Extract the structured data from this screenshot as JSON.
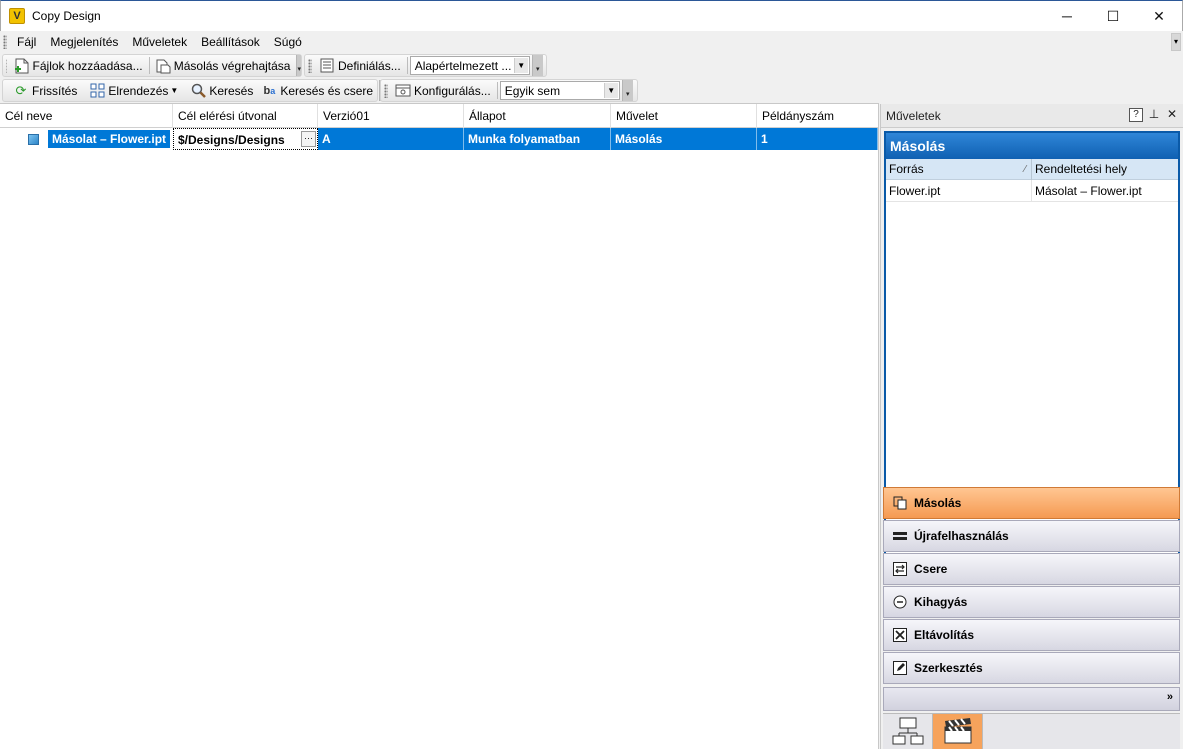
{
  "window": {
    "title": "Copy Design",
    "app_icon_letter": "V",
    "controls": {
      "minimize": "─",
      "maximize": "☐",
      "close": "✕"
    }
  },
  "menu": [
    "Fájl",
    "Megjelenítés",
    "Műveletek",
    "Beállítások",
    "Súgó"
  ],
  "toolbar1": {
    "add_files": "Fájlok hozzáadása...",
    "execute_copy": "Másolás végrehajtása",
    "define": "Definiálás...",
    "preset_value": "Alapértelmezett ..."
  },
  "toolbar2": {
    "refresh": "Frissítés",
    "arrange": "Elrendezés",
    "search": "Keresés",
    "search_replace": "Keresés és csere",
    "configure": "Konfigurálás...",
    "filter_value": "Egyik sem"
  },
  "grid": {
    "columns": [
      "Cél neve",
      "Cél elérési útvonal",
      "Verzió01",
      "Állapot",
      "Művelet",
      "Példányszám"
    ],
    "rows": [
      {
        "name": "Másolat – Flower.ipt",
        "path": "$/Designs/Designs",
        "version": "A",
        "status": "Munka folyamatban",
        "action": "Másolás",
        "count": "1"
      }
    ]
  },
  "panel": {
    "title": "Műveletek",
    "header": "Másolás",
    "columns": [
      "Forrás",
      "Rendeltetési hely"
    ],
    "rows": [
      {
        "source": "Flower.ipt",
        "dest": "Másolat – Flower.ipt"
      }
    ],
    "actions": [
      {
        "label": "Másolás",
        "icon": "copy-icon"
      },
      {
        "label": "Újrafelhasználás",
        "icon": "reuse-icon"
      },
      {
        "label": "Csere",
        "icon": "replace-icon"
      },
      {
        "label": "Kihagyás",
        "icon": "skip-icon"
      },
      {
        "label": "Eltávolítás",
        "icon": "remove-icon"
      },
      {
        "label": "Szerkesztés",
        "icon": "edit-icon"
      }
    ]
  }
}
